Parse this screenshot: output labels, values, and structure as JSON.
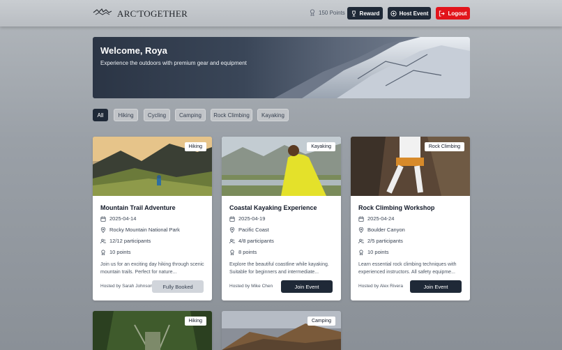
{
  "header": {
    "brand": "ARC'TOGETHER",
    "points": "150 Points",
    "reward_label": "Reward",
    "host_event_label": "Host Event",
    "logout_label": "Logout"
  },
  "hero": {
    "title": "Welcome, Roya",
    "subtitle": "Experience the outdoors with premium gear and equipment"
  },
  "filters": [
    "All",
    "Hiking",
    "Cycling",
    "Camping",
    "Rock Climbing",
    "Kayaking"
  ],
  "active_filter": "All",
  "cards": [
    {
      "tag": "Hiking",
      "title": "Mountain Trail Adventure",
      "date": "2025-04-14",
      "location": "Rocky Mountain National Park",
      "participants": "12/12 participants",
      "points": "10 points",
      "description": "Join us for an exciting day hiking through scenic mountain trails. Perfect for nature...",
      "host": "Hosted by Sarah Johnson",
      "button": "Fully Booked"
    },
    {
      "tag": "Kayaking",
      "title": "Coastal Kayaking Experience",
      "date": "2025-04-19",
      "location": "Pacific Coast",
      "participants": "4/8 participants",
      "points": "8 points",
      "description": "Explore the beautiful coastline while kayaking. Suitable for beginners and intermediate...",
      "host": "Hosted by Mike Chen",
      "button": "Join Event"
    },
    {
      "tag": "Rock Climbing",
      "title": "Rock Climbing Workshop",
      "date": "2025-04-24",
      "location": "Boulder Canyon",
      "participants": "2/5 participants",
      "points": "10 points",
      "description": "Learn essential rock climbing techniques with experienced instructors. All safety equipme...",
      "host": "Hosted by Alex Rivera",
      "button": "Join Event"
    },
    {
      "tag": "Hiking"
    },
    {
      "tag": "Camping"
    }
  ],
  "colors": {
    "primary_dark": "#1f2937",
    "logout_red": "#e2141b"
  }
}
